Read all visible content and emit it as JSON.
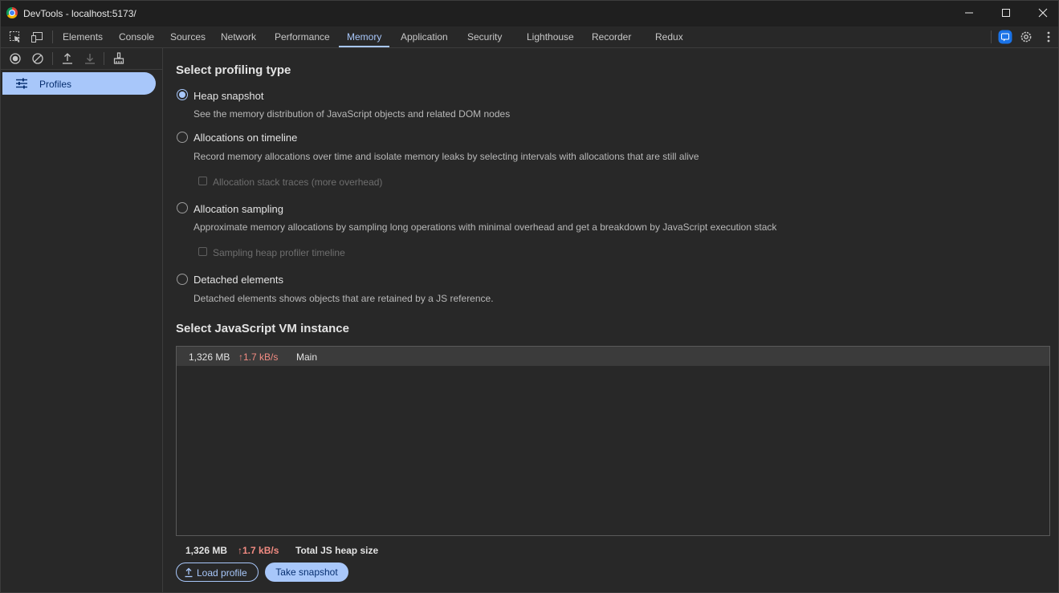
{
  "window": {
    "title": "DevTools - localhost:5173/"
  },
  "tabs": [
    "Elements",
    "Console",
    "Sources",
    "Network",
    "Performance",
    "Memory",
    "Application",
    "Security",
    "Lighthouse",
    "Recorder",
    "Redux"
  ],
  "active_tab": "Memory",
  "sidebar": {
    "profiles_label": "Profiles"
  },
  "profiling": {
    "heading": "Select profiling type",
    "options": [
      {
        "label": "Heap snapshot",
        "desc": "See the memory distribution of JavaScript objects and related DOM nodes",
        "checked": true
      },
      {
        "label": "Allocations on timeline",
        "desc": "Record memory allocations over time and isolate memory leaks by selecting intervals with allocations that are still alive",
        "checked": false,
        "suboption": "Allocation stack traces (more overhead)"
      },
      {
        "label": "Allocation sampling",
        "desc": "Approximate memory allocations by sampling long operations with minimal overhead and get a breakdown by JavaScript execution stack",
        "checked": false,
        "suboption": "Sampling heap profiler timeline"
      },
      {
        "label": "Detached elements",
        "desc": "Detached elements shows objects that are retained by a JS reference.",
        "checked": false
      }
    ]
  },
  "vm": {
    "heading": "Select JavaScript VM instance",
    "row": {
      "size": "1,326 MB",
      "rate": "↑1.7 kB/s",
      "name": "Main"
    }
  },
  "footer": {
    "size": "1,326 MB",
    "rate": "↑1.7 kB/s",
    "label": "Total JS heap size"
  },
  "buttons": {
    "load": "Load profile",
    "snapshot": "Take snapshot"
  },
  "colors": {
    "accent": "#a8c7fa",
    "rate": "#f28b82",
    "background": "#282828"
  }
}
